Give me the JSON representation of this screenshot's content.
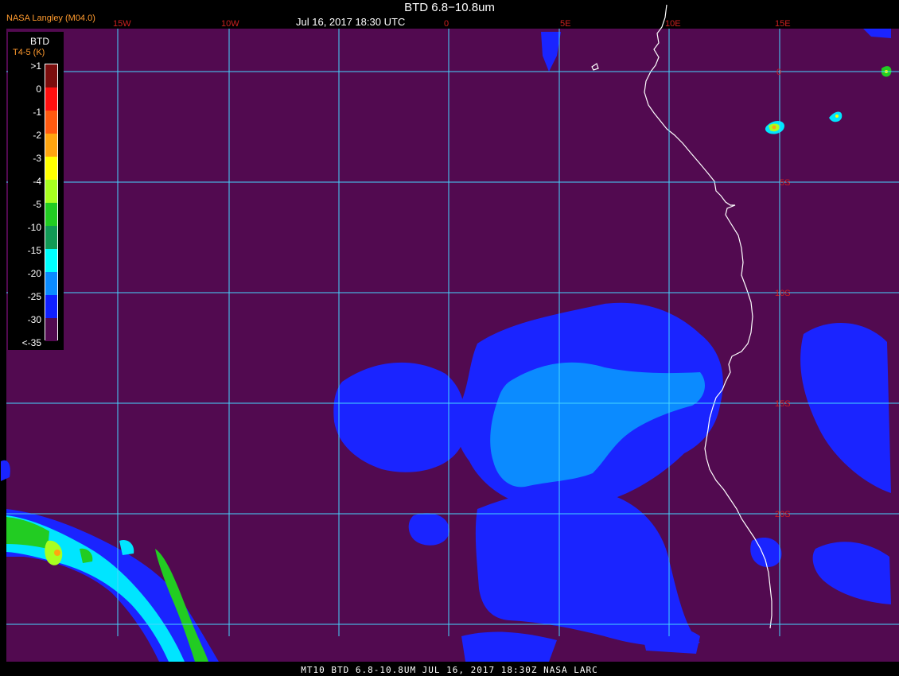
{
  "header": {
    "credit": "NASA Langley (M04.0)",
    "title": "BTD 6.8−10.8um",
    "datetime": "Jul 16, 2017 18:30 UTC"
  },
  "footer": "MT10  BTD 6.8-10.8UM  JUL 16, 2017 18:30Z  NASA LARC",
  "legend": {
    "title": "BTD",
    "units": "T4-5 (K)",
    "levels": [
      {
        "label": ">1",
        "color": "#7a0d0d"
      },
      {
        "label": "0",
        "color": "#ff1010"
      },
      {
        "label": "-1",
        "color": "#ff5a10"
      },
      {
        "label": "-2",
        "color": "#ffa510"
      },
      {
        "label": "-3",
        "color": "#ffff00"
      },
      {
        "label": "-4",
        "color": "#a8ff20"
      },
      {
        "label": "-5",
        "color": "#22cc22"
      },
      {
        "label": "-10",
        "color": "#119955"
      },
      {
        "label": "-15",
        "color": "#00ffff"
      },
      {
        "label": "-20",
        "color": "#0b8bff"
      },
      {
        "label": "-25",
        "color": "#1020ff"
      },
      {
        "label": "-30",
        "color": "#520a50"
      },
      {
        "label": "<-35",
        "color": "#520a50"
      }
    ]
  },
  "map": {
    "background_color": "#520a50",
    "grid_color": "#46d6ff",
    "coast_color": "#ffffff",
    "label_color": "#cc2020",
    "lon_labels": [
      "15W",
      "10W",
      "0",
      "5E",
      "10E",
      "15E"
    ],
    "lat_labels": [
      "0",
      "5S",
      "10S",
      "15S",
      "20S"
    ]
  }
}
